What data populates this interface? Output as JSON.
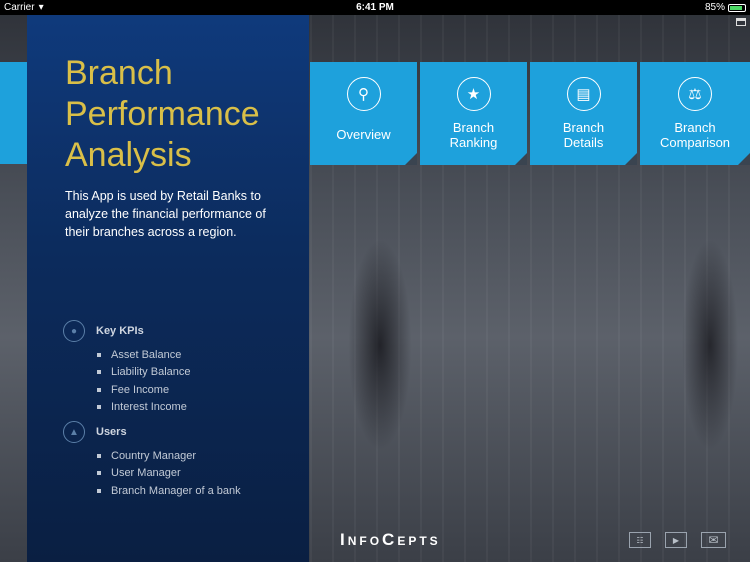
{
  "status_bar": {
    "carrier": "Carrier",
    "wifi_icon": "wifi-icon",
    "time": "6:41 PM",
    "battery": "85%",
    "battery_level": 0.85
  },
  "panel": {
    "title_lines": [
      "Branch",
      "Performance",
      "Analysis"
    ],
    "description": "This App is used by Retail Banks to analyze the financial performance of their branches across a region.",
    "kpis": {
      "heading": "Key KPIs",
      "items": [
        "Asset Balance",
        "Liability Balance",
        "Fee Income",
        "Interest Income"
      ]
    },
    "users": {
      "heading": "Users",
      "items": [
        "Country Manager",
        "User Manager",
        "Branch Manager of a bank"
      ]
    }
  },
  "tiles": [
    {
      "label1": "Overview",
      "label2": "",
      "icon": "search-icon"
    },
    {
      "label1": "Branch",
      "label2": "Ranking",
      "icon": "star-icon"
    },
    {
      "label1": "Branch",
      "label2": "Details",
      "icon": "document-icon"
    },
    {
      "label1": "Branch",
      "label2": "Comparison",
      "icon": "scales-icon"
    }
  ],
  "footer": {
    "logo": "InfoCepts",
    "icons": [
      "hierarchy-icon",
      "play-icon",
      "mail-icon"
    ]
  },
  "colors": {
    "accent": "#1ea1dc",
    "title": "#d9bf48",
    "panel": "#0c2b5c"
  }
}
